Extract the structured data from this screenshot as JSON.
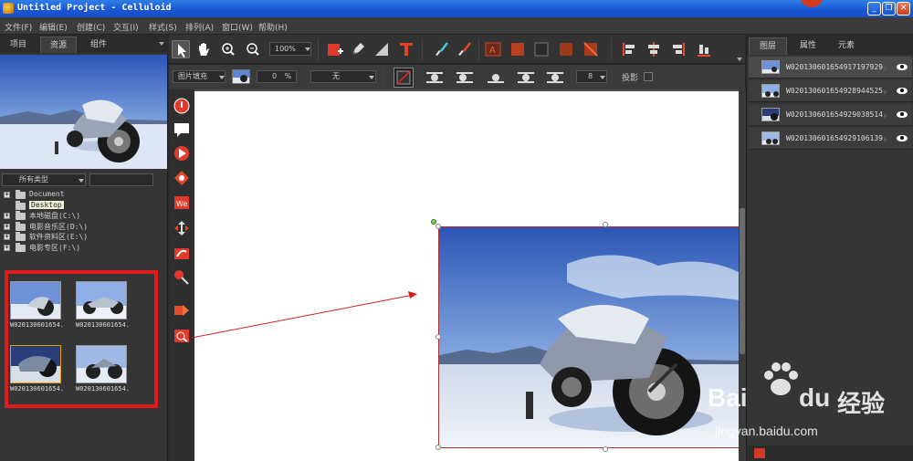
{
  "window": {
    "title": "Untitled Project - Celluloid",
    "minimize_label": "_",
    "restore_label": "❐",
    "close_label": "✕"
  },
  "menu": [
    "文件(F)",
    "编辑(E)",
    "创建(C)",
    "交互(I)",
    "样式(S)",
    "排列(A)",
    "窗口(W)",
    "帮助(H)"
  ],
  "left_panel": {
    "tabs": [
      "项目",
      "资源",
      "组件"
    ],
    "active_tab": "资源",
    "filter_type": "所有类型",
    "tree": [
      {
        "label": "Document",
        "expander": "+"
      },
      {
        "label": "Desktop",
        "expander": "",
        "selected": true
      },
      {
        "label": "本地磁盘(C:\\)",
        "expander": "+"
      },
      {
        "label": "电影音乐区(D:\\)",
        "expander": "+"
      },
      {
        "label": "软件资料区(E:\\)",
        "expander": "+"
      },
      {
        "label": "电影专区(F:\\)",
        "expander": "+"
      }
    ],
    "thumbnails": [
      {
        "caption": "W020130601654..."
      },
      {
        "caption": "W020130601654..."
      },
      {
        "caption": "W020130601654..."
      },
      {
        "caption": "W020130601654..."
      }
    ]
  },
  "toolbar": {
    "zoom": "100%",
    "fill_mode": "图片填充",
    "spin_value": "0",
    "spin_unit": "%",
    "none_select": "无",
    "stroke_width": "8",
    "shadow_label": "投影"
  },
  "right_panel": {
    "tabs": [
      "图层",
      "属性",
      "元素"
    ],
    "active_tab": "图层",
    "layers": [
      {
        "name": "W020130601654917197929"
      },
      {
        "name": "W020130601654928944525"
      },
      {
        "name": "W020130601654929038514"
      },
      {
        "name": "W020130601654929106139"
      }
    ]
  },
  "watermark": {
    "brand": "Bai",
    "brand2": "du",
    "cn": "经验",
    "url": "jingyan.baidu.com"
  },
  "colors": {
    "accent_red": "#e01b1b",
    "titlebar_blue": "#1755d4",
    "panel_bg": "#353535"
  }
}
